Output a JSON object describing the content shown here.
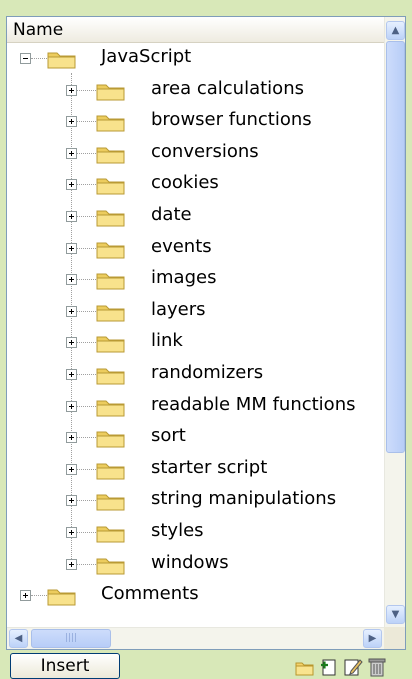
{
  "header": {
    "column_name": "Name"
  },
  "tree": {
    "root": {
      "label": "JavaScript",
      "expanded": true
    },
    "children": [
      "area calculations",
      "browser functions",
      "conversions",
      "cookies",
      "date",
      "events",
      "images",
      "layers",
      "link",
      "randomizers",
      "readable MM functions",
      "sort",
      "starter script",
      "string manipulations",
      "styles",
      "windows"
    ],
    "next_root": {
      "label": "Comments",
      "expanded": false
    }
  },
  "toolbar": {
    "insert_label": "Insert",
    "icons": [
      "new-folder-icon",
      "new-item-icon",
      "edit-icon",
      "delete-icon"
    ]
  }
}
